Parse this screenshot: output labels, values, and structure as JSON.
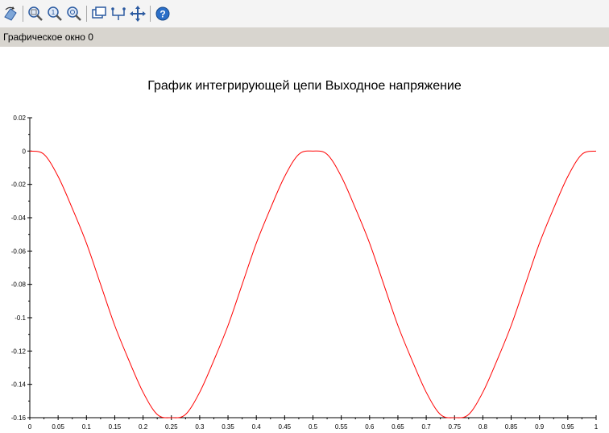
{
  "window": {
    "title": "Графическое окно 0"
  },
  "toolbar": {
    "buttons": [
      {
        "name": "rotate-icon"
      },
      {
        "name": "zoom-area-icon"
      },
      {
        "name": "zoom-in-icon"
      },
      {
        "name": "zoom-out-icon"
      },
      {
        "name": "datatip-icon"
      },
      {
        "name": "edit-curve-icon"
      },
      {
        "name": "pan-icon"
      },
      {
        "name": "help-icon"
      }
    ]
  },
  "chart_data": {
    "type": "line",
    "title": "График интегрирующей цепи Выходное напряжение",
    "xlabel": "",
    "ylabel": "",
    "xlim": [
      0,
      1
    ],
    "ylim": [
      -0.16,
      0.02
    ],
    "x_ticks": [
      "0",
      "0.05",
      "0.1",
      "0.15",
      "0.2",
      "0.25",
      "0.3",
      "0.35",
      "0.4",
      "0.45",
      "0.5",
      "0.55",
      "0.6",
      "0.65",
      "0.7",
      "0.75",
      "0.8",
      "0.85",
      "0.9",
      "0.95",
      "1"
    ],
    "y_ticks": [
      "0.02",
      "0",
      "-0.02",
      "-0.04",
      "-0.06",
      "-0.08",
      "-0.1",
      "-0.12",
      "-0.14",
      "-0.16"
    ],
    "grid": false,
    "series": [
      {
        "color": "#ff0000",
        "x": [
          0,
          0.025,
          0.05,
          0.075,
          0.1,
          0.125,
          0.15,
          0.175,
          0.2,
          0.225,
          0.25,
          0.275,
          0.3,
          0.325,
          0.35,
          0.375,
          0.4,
          0.425,
          0.45,
          0.475,
          0.5,
          0.525,
          0.55,
          0.575,
          0.6,
          0.625,
          0.65,
          0.675,
          0.7,
          0.725,
          0.75,
          0.775,
          0.8,
          0.825,
          0.85,
          0.875,
          0.9,
          0.925,
          0.95,
          0.975,
          1
        ],
        "y": [
          0,
          -0.00195,
          -0.01528,
          -0.0344,
          -0.05528,
          -0.08,
          -0.10472,
          -0.1256,
          -0.14472,
          -0.15805,
          -0.16,
          -0.15805,
          -0.14472,
          -0.1256,
          -0.10472,
          -0.08,
          -0.05528,
          -0.0344,
          -0.01528,
          -0.00195,
          0,
          -0.00195,
          -0.01528,
          -0.0344,
          -0.05528,
          -0.08,
          -0.10472,
          -0.1256,
          -0.14472,
          -0.15805,
          -0.16,
          -0.15805,
          -0.14472,
          -0.1256,
          -0.10472,
          -0.08,
          -0.05528,
          -0.0344,
          -0.01528,
          -0.00195,
          0
        ]
      }
    ]
  }
}
